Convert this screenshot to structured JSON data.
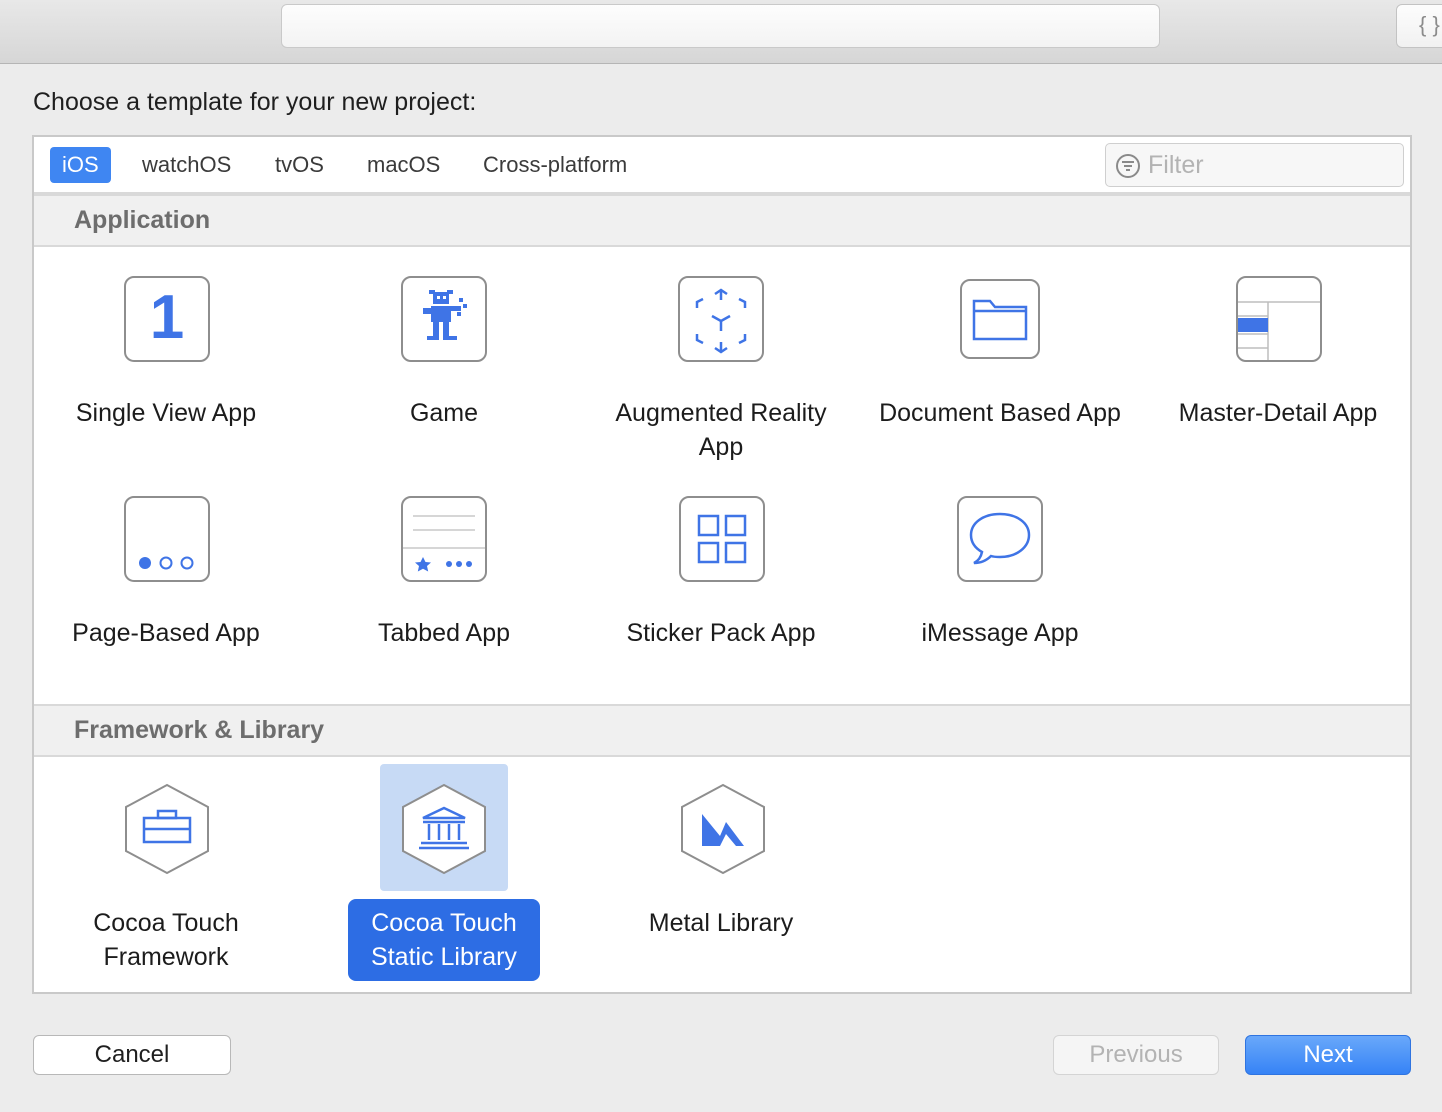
{
  "toolbar": {
    "code_button_label": "{ }"
  },
  "prompt": "Choose a template for your new project:",
  "tabs": [
    {
      "label": "iOS",
      "active": true
    },
    {
      "label": "watchOS",
      "active": false
    },
    {
      "label": "tvOS",
      "active": false
    },
    {
      "label": "macOS",
      "active": false
    },
    {
      "label": "Cross-platform",
      "active": false
    }
  ],
  "filter": {
    "placeholder": "Filter",
    "value": ""
  },
  "sections": {
    "application": {
      "title": "Application",
      "items": [
        {
          "label": "Single View App",
          "icon": "single-view-icon"
        },
        {
          "label": "Game",
          "icon": "game-icon"
        },
        {
          "label": "Augmented Reality App",
          "icon": "ar-cube-icon"
        },
        {
          "label": "Document Based App",
          "icon": "folder-icon"
        },
        {
          "label": "Master-Detail App",
          "icon": "master-detail-icon"
        },
        {
          "label": "Page-Based App",
          "icon": "page-dots-icon"
        },
        {
          "label": "Tabbed App",
          "icon": "tab-bar-icon"
        },
        {
          "label": "Sticker Pack App",
          "icon": "grid-icon"
        },
        {
          "label": "iMessage App",
          "icon": "speech-bubble-icon"
        }
      ],
      "single_view_glyph": "1"
    },
    "framework": {
      "title": "Framework & Library",
      "items": [
        {
          "label": "Cocoa Touch Framework",
          "icon": "toolbox-icon",
          "selected": false
        },
        {
          "label": "Cocoa Touch Static Library",
          "icon": "library-building-icon",
          "selected": true
        },
        {
          "label": "Metal Library",
          "icon": "metal-icon",
          "selected": false
        }
      ]
    }
  },
  "buttons": {
    "cancel": "Cancel",
    "previous": "Previous",
    "next": "Next"
  },
  "colors": {
    "accent": "#3f86f2",
    "icon_blue": "#3f74e6",
    "selection_bg": "#c7daf5",
    "selection_label": "#2d6de4"
  }
}
